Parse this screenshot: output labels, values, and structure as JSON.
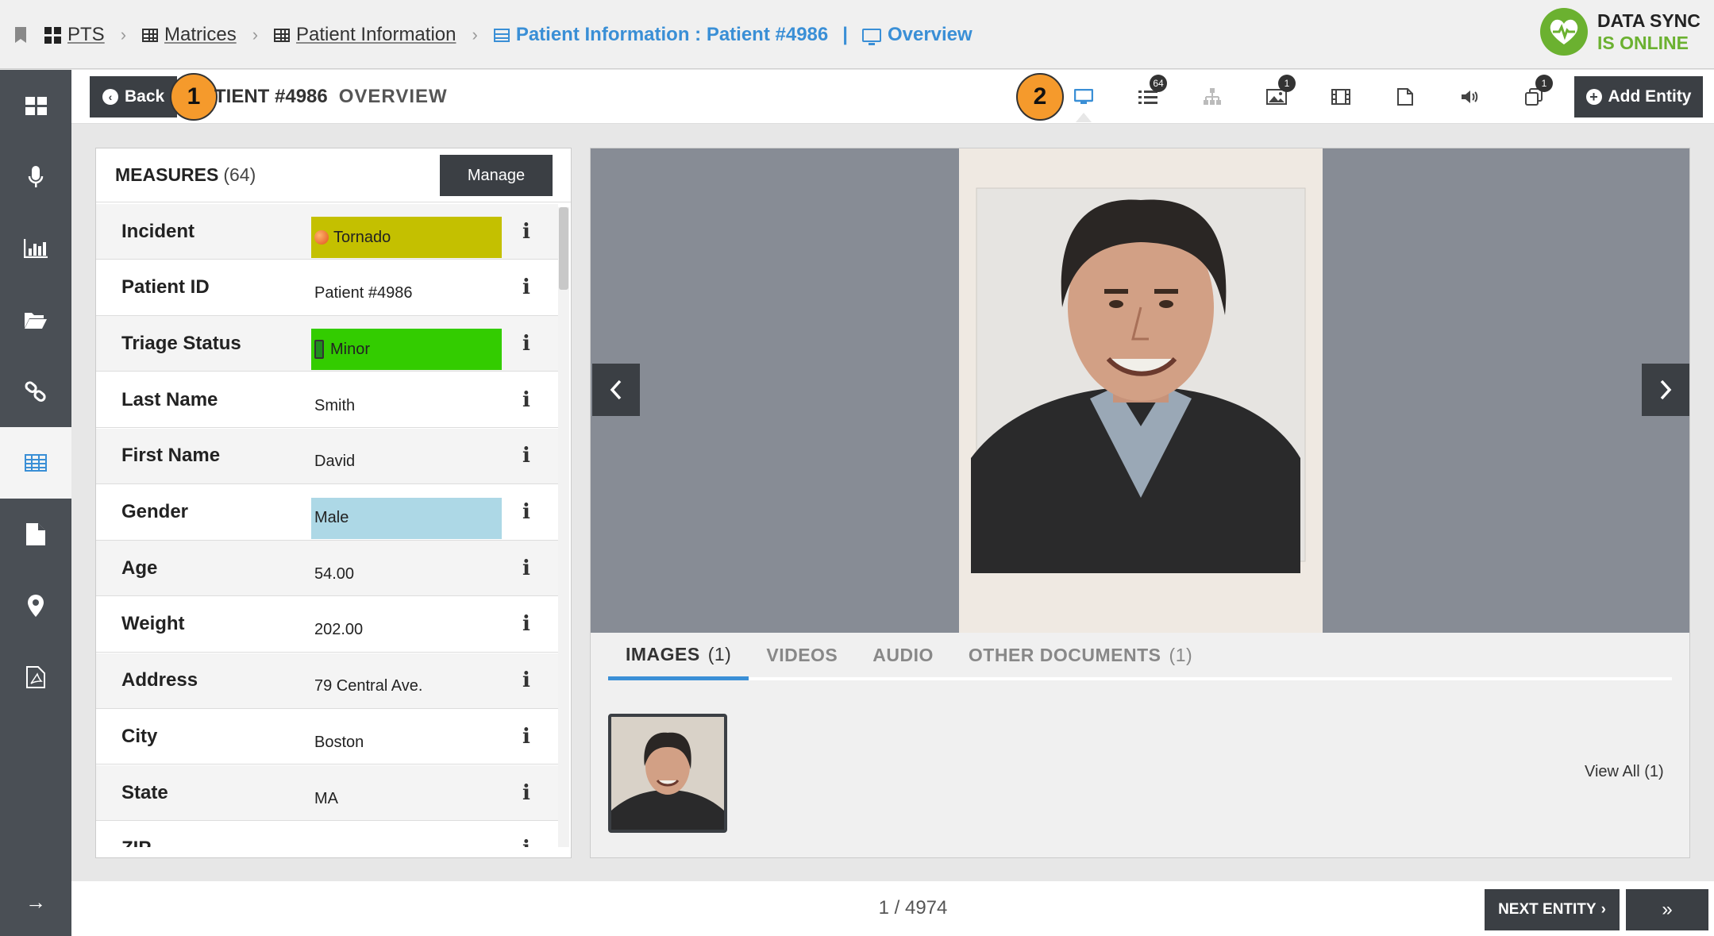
{
  "breadcrumb": {
    "items": [
      {
        "label": "PTS"
      },
      {
        "label": "Matrices"
      },
      {
        "label": "Patient Information"
      }
    ],
    "active": "Patient Information : Patient #4986",
    "separator": "|",
    "view": "Overview"
  },
  "sync": {
    "line1": "DATA SYNC",
    "line2": "IS ONLINE",
    "color": "#6bb130"
  },
  "header": {
    "back_label": "Back",
    "title": "TIENT #4986",
    "subtitle": "OVERVIEW",
    "callout1": "1",
    "callout2": "2",
    "add_entity": "Add Entity"
  },
  "toolbar": {
    "measures_count": "64",
    "images_count": "1",
    "other_docs_count": "1"
  },
  "measures": {
    "label": "MEASURES",
    "count": "(64)",
    "manage": "Manage",
    "rows": [
      {
        "key": "Incident",
        "value": "Tornado",
        "bg": "#c4c000",
        "marker": "orange-dot"
      },
      {
        "key": "Patient ID",
        "value": "Patient #4986",
        "bg": ""
      },
      {
        "key": "Triage Status",
        "value": "Minor",
        "bg": "#33cc00",
        "marker": "green-tag"
      },
      {
        "key": "Last Name",
        "value": "Smith",
        "bg": ""
      },
      {
        "key": "First Name",
        "value": "David",
        "bg": ""
      },
      {
        "key": "Gender",
        "value": "Male",
        "bg": "#add8e6"
      },
      {
        "key": "Age",
        "value": "54.00",
        "bg": ""
      },
      {
        "key": "Weight",
        "value": "202.00",
        "bg": ""
      },
      {
        "key": "Address",
        "value": "79 Central Ave.",
        "bg": ""
      },
      {
        "key": "City",
        "value": "Boston",
        "bg": ""
      },
      {
        "key": "State",
        "value": "MA",
        "bg": ""
      },
      {
        "key": "ZIP",
        "value": "",
        "bg": ""
      }
    ]
  },
  "media": {
    "tabs": [
      {
        "label": "IMAGES",
        "count": "(1)",
        "active": true
      },
      {
        "label": "VIDEOS",
        "count": ""
      },
      {
        "label": "AUDIO",
        "count": ""
      },
      {
        "label": "OTHER DOCUMENTS",
        "count": "(1)"
      }
    ],
    "view_all": "View All (1)"
  },
  "footer": {
    "pager": "1 / 4974",
    "next_entity": "NEXT ENTITY"
  },
  "colors": {
    "accent": "#3a8fd6",
    "dark": "#3b3f44",
    "callout": "#f59a2c"
  }
}
